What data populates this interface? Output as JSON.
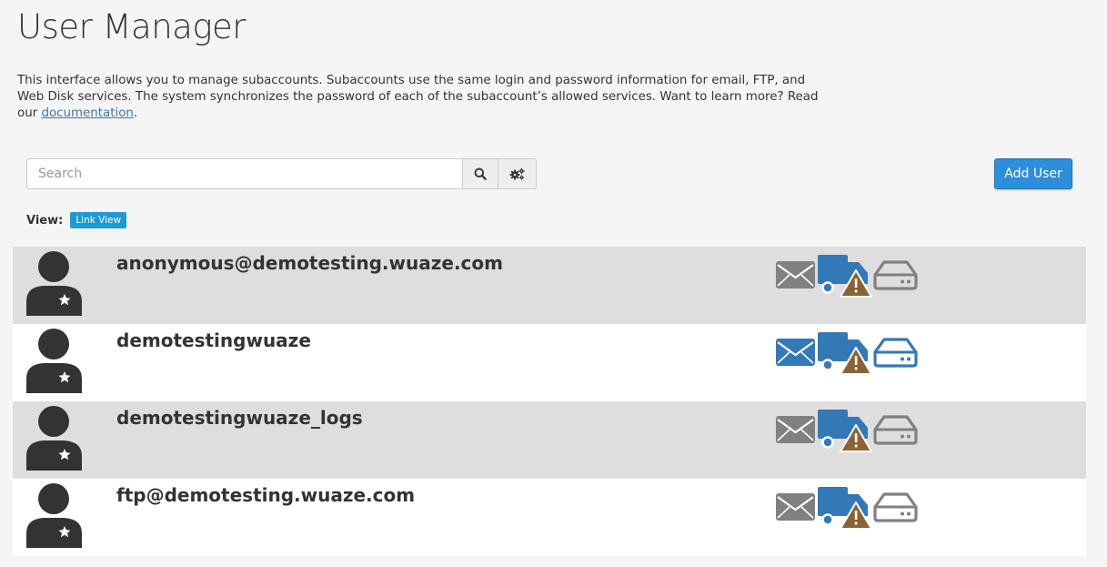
{
  "page": {
    "title": "User Manager",
    "intro_text": "This interface allows you to manage subaccounts. Subaccounts use the same login and password information for email, FTP, and Web Disk services. The system synchronizes the password of each of the subaccount’s allowed services. Want to learn more? Read our ",
    "intro_link": "documentation",
    "intro_end": "."
  },
  "search": {
    "placeholder": "Search",
    "search_icon": "search-icon",
    "settings_icon": "cogs-icon"
  },
  "toolbar": {
    "add_user_label": "Add User"
  },
  "view": {
    "label": "View:",
    "mode": "Link View"
  },
  "colors": {
    "active_service": "#3379b7",
    "inactive_service": "#808080",
    "warning": "#8a6334",
    "accent_button": "#2d8fdc",
    "row_alt": "#dedede"
  },
  "users": [
    {
      "name": "anonymous@demotesting.wuaze.com",
      "email": "inactive",
      "ftp": "active-warning",
      "webdisk": "inactive"
    },
    {
      "name": "demotestingwuaze",
      "email": "active",
      "ftp": "active-warning",
      "webdisk": "active"
    },
    {
      "name": "demotestingwuaze_logs",
      "email": "inactive",
      "ftp": "active-warning",
      "webdisk": "inactive"
    },
    {
      "name": "ftp@demotesting.wuaze.com",
      "email": "inactive",
      "ftp": "active-warning",
      "webdisk": "inactive"
    }
  ]
}
